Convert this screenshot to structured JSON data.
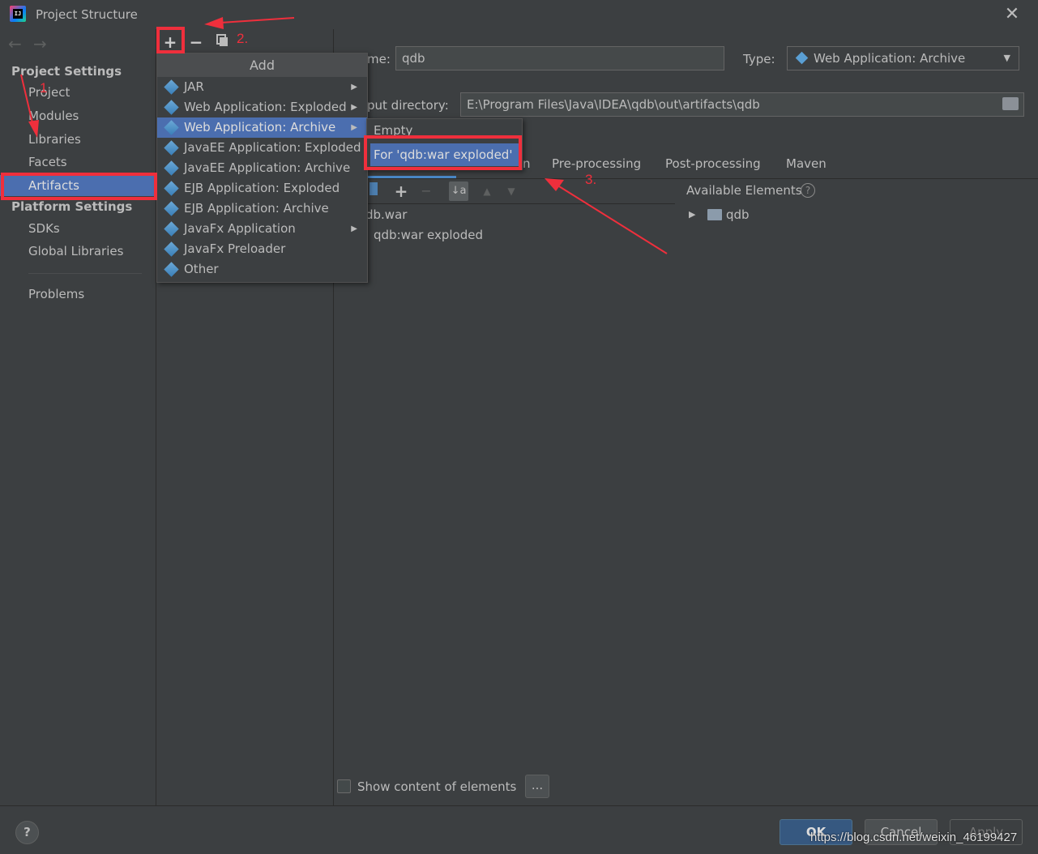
{
  "window": {
    "title": "Project Structure"
  },
  "sidebar": {
    "project_settings": "Project Settings",
    "items": [
      {
        "label": "Project"
      },
      {
        "label": "Modules"
      },
      {
        "label": "Libraries"
      },
      {
        "label": "Facets"
      },
      {
        "label": "Artifacts"
      }
    ],
    "platform_settings": "Platform Settings",
    "platform_items": [
      {
        "label": "SDKs"
      },
      {
        "label": "Global Libraries"
      }
    ],
    "problems": "Problems"
  },
  "toolbar": {
    "add": "+",
    "remove": "−"
  },
  "editor": {
    "name_label": "me:",
    "name_value": "qdb",
    "type_label": "Type:",
    "type_value": "Web Application: Archive",
    "output_label": "put directory:",
    "output_value": "E:\\Program Files\\Java\\IDEA\\qdb\\out\\artifacts\\qdb",
    "tabs": [
      {
        "label": "n"
      },
      {
        "label": "Pre-processing"
      },
      {
        "label": "Post-processing"
      },
      {
        "label": "Maven"
      }
    ],
    "tree": [
      {
        "label": "db.war"
      },
      {
        "label": "qdb:war exploded"
      }
    ],
    "available_elements": "Available Elements",
    "available_tree": [
      {
        "label": "qdb"
      }
    ],
    "show_content": "Show content of elements",
    "dots": "..."
  },
  "add_menu": {
    "title": "Add",
    "items": [
      {
        "label": "JAR",
        "submenu": true
      },
      {
        "label": "Web Application: Exploded",
        "submenu": true
      },
      {
        "label": "Web Application: Archive",
        "submenu": true
      },
      {
        "label": "JavaEE Application: Exploded",
        "submenu": false
      },
      {
        "label": "JavaEE Application: Archive",
        "submenu": false
      },
      {
        "label": "EJB Application: Exploded",
        "submenu": false
      },
      {
        "label": "EJB Application: Archive",
        "submenu": false
      },
      {
        "label": "JavaFx Application",
        "submenu": true
      },
      {
        "label": "JavaFx Preloader",
        "submenu": false
      },
      {
        "label": "Other",
        "submenu": false
      }
    ]
  },
  "submenu": {
    "items": [
      {
        "label": "Empty"
      },
      {
        "label": "For 'qdb:war exploded'"
      }
    ]
  },
  "buttons": {
    "help": "?",
    "ok": "OK",
    "cancel": "Cancel",
    "apply": "Apply"
  },
  "annotations": {
    "step1": "1",
    "step2": "2.",
    "step3": "3."
  },
  "watermark": "https://blog.csdn.net/weixin_46199427",
  "colors": {
    "accent": "#4b6eaf",
    "annotation": "#ef2f3c"
  }
}
